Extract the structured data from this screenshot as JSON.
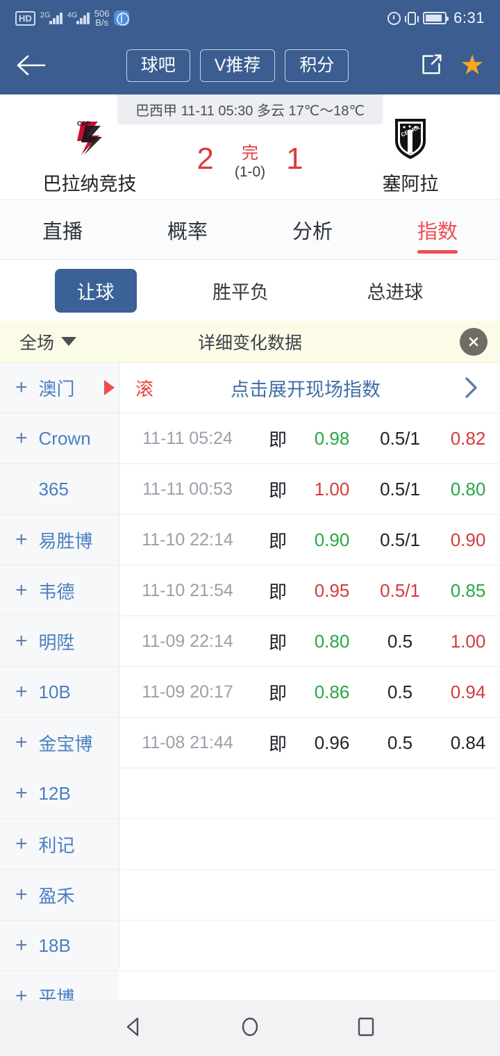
{
  "status_bar": {
    "hd_label": "HD",
    "sim1_gen": "2G",
    "sim2_gen": "4G",
    "net_speed_value": "506",
    "net_speed_unit": "B/s",
    "globe_icon": "globe-icon",
    "alarm_icon": "alarm-icon",
    "vibrate_icon": "vibrate-icon",
    "battery_icon": "battery-icon",
    "clock": "6:31"
  },
  "nav_bar": {
    "back_icon": "back-arrow-icon",
    "buttons": [
      {
        "label": "球吧"
      },
      {
        "label": "V推荐"
      },
      {
        "label": "积分"
      }
    ],
    "share_icon": "share-icon",
    "favorite_icon": "star-icon"
  },
  "match": {
    "league_banner": "巴西甲 11-11 05:30 多云 17℃～18℃",
    "home_team": "巴拉纳竞技",
    "home_score": "2",
    "away_team": "塞阿拉",
    "away_score": "1",
    "status": "完",
    "half_time": "(1-0)",
    "home_crest_colors": {
      "red": "#c8102e",
      "black": "#1a1a1a"
    },
    "away_crest_colors": {
      "black": "#111111",
      "white": "#ffffff"
    }
  },
  "tabs": [
    {
      "label": "直播",
      "active": false
    },
    {
      "label": "概率",
      "active": false
    },
    {
      "label": "分析",
      "active": false
    },
    {
      "label": "指数",
      "active": true
    }
  ],
  "sub_tabs": [
    {
      "label": "让球",
      "active": true
    },
    {
      "label": "胜平负",
      "active": false
    },
    {
      "label": "总进球",
      "active": false
    }
  ],
  "filter_bar": {
    "scope_label": "全场",
    "caret_icon": "chevron-down-icon",
    "title": "详细变化数据",
    "close_icon": "close-icon",
    "close_bg": "#6e6c63",
    "background": "#fbfbe8"
  },
  "table": {
    "rows": [
      {
        "bookmaker": "澳门",
        "has_plus": true,
        "has_marker": true,
        "type": "expand",
        "roll_label": "滚",
        "expand_text": "点击展开现场指数",
        "chevron_icon": "chevron-right-icon"
      },
      {
        "bookmaker": "Crown",
        "has_plus": true,
        "has_marker": false,
        "type": "odds",
        "time": "11-11 05:24",
        "kind": "即",
        "home_odds": "0.98",
        "home_dir": "up",
        "handicap": "0.5/1",
        "handicap_dir": "flat",
        "away_odds": "0.82",
        "away_dir": "down"
      },
      {
        "bookmaker": "365",
        "has_plus": false,
        "has_marker": false,
        "type": "odds",
        "time": "11-11 00:53",
        "kind": "即",
        "home_odds": "1.00",
        "home_dir": "down",
        "handicap": "0.5/1",
        "handicap_dir": "flat",
        "away_odds": "0.80",
        "away_dir": "up"
      },
      {
        "bookmaker": "易胜博",
        "has_plus": true,
        "has_marker": false,
        "type": "odds",
        "time": "11-10 22:14",
        "kind": "即",
        "home_odds": "0.90",
        "home_dir": "up",
        "handicap": "0.5/1",
        "handicap_dir": "flat",
        "away_odds": "0.90",
        "away_dir": "down"
      },
      {
        "bookmaker": "韦德",
        "has_plus": true,
        "has_marker": false,
        "type": "odds",
        "time": "11-10 21:54",
        "kind": "即",
        "home_odds": "0.95",
        "home_dir": "down",
        "handicap": "0.5/1",
        "handicap_dir": "down",
        "away_odds": "0.85",
        "away_dir": "up"
      },
      {
        "bookmaker": "明陞",
        "has_plus": true,
        "has_marker": false,
        "type": "odds",
        "time": "11-09 22:14",
        "kind": "即",
        "home_odds": "0.80",
        "home_dir": "up",
        "handicap": "0.5",
        "handicap_dir": "flat",
        "away_odds": "1.00",
        "away_dir": "down"
      },
      {
        "bookmaker": "10B",
        "has_plus": true,
        "has_marker": false,
        "type": "odds",
        "time": "11-09 20:17",
        "kind": "即",
        "home_odds": "0.86",
        "home_dir": "up",
        "handicap": "0.5",
        "handicap_dir": "flat",
        "away_odds": "0.94",
        "away_dir": "down"
      },
      {
        "bookmaker": "金宝博",
        "has_plus": true,
        "has_marker": false,
        "type": "odds",
        "time": "11-08 21:44",
        "kind": "即",
        "home_odds": "0.96",
        "home_dir": "flat",
        "handicap": "0.5",
        "handicap_dir": "flat",
        "away_odds": "0.84",
        "away_dir": "flat"
      },
      {
        "bookmaker": "12B",
        "has_plus": true,
        "has_marker": false,
        "type": "empty"
      },
      {
        "bookmaker": "利记",
        "has_plus": true,
        "has_marker": false,
        "type": "empty"
      },
      {
        "bookmaker": "盈禾",
        "has_plus": true,
        "has_marker": false,
        "type": "empty"
      },
      {
        "bookmaker": "18B",
        "has_plus": true,
        "has_marker": false,
        "type": "empty"
      },
      {
        "bookmaker": "平博",
        "has_plus": true,
        "has_marker": false,
        "type": "empty"
      }
    ]
  },
  "android_nav": {
    "back_icon": "android-back-icon",
    "home_icon": "android-home-icon",
    "recents_icon": "android-recents-icon"
  },
  "colors": {
    "header_blue": "#3b5d8f",
    "accent_red": "#ef4d52",
    "link_blue": "#4a7fc1",
    "up_green": "#27a744",
    "down_red": "#d53a3a"
  }
}
